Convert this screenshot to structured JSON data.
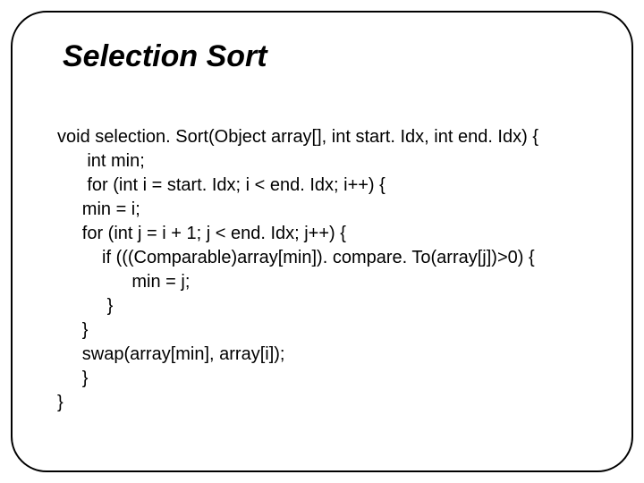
{
  "title": "Selection Sort",
  "code": {
    "l1": "void selection. Sort(Object array[], int start. Idx, int end. Idx) {",
    "l2": "      int min;",
    "l3": "      for (int i = start. Idx; i < end. Idx; i++) {",
    "l4": "     min = i;",
    "l5": "     for (int j = i + 1; j < end. Idx; j++) {",
    "l6": "         if (((Comparable)array[min]). compare. To(array[j])>0) {",
    "l7": "               min = j;",
    "l8": "          }",
    "l9": "     }",
    "l10": "     swap(array[min], array[i]);",
    "l11": "     }",
    "l12": "}"
  }
}
